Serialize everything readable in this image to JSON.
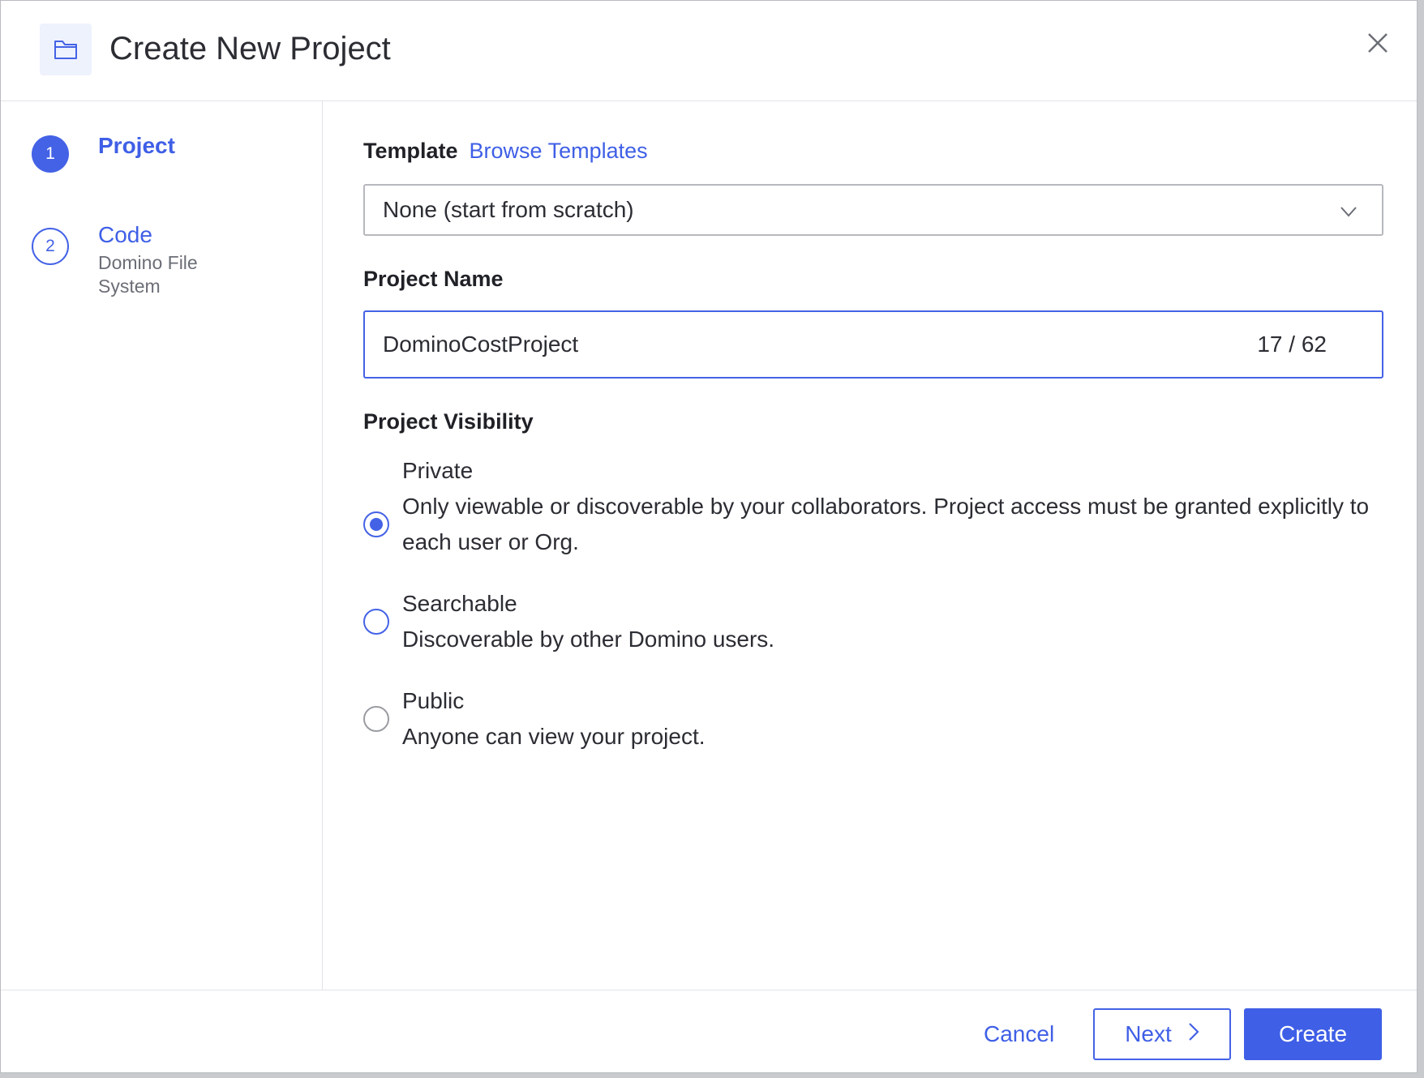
{
  "dialog": {
    "title": "Create New Project"
  },
  "steps": [
    {
      "number": "1",
      "label": "Project",
      "sub": ""
    },
    {
      "number": "2",
      "label": "Code",
      "sub": "Domino File System"
    }
  ],
  "form": {
    "template_label": "Template",
    "browse_templates": "Browse Templates",
    "template_value": "None (start from scratch)",
    "project_name_label": "Project Name",
    "project_name_value": "DominoCostProject",
    "project_name_counter": "17 / 62",
    "visibility_label": "Project Visibility",
    "visibility_options": [
      {
        "title": "Private",
        "desc": "Only viewable or discoverable by your collaborators. Project access must be granted explicitly to each user or Org.",
        "selected": true
      },
      {
        "title": "Searchable",
        "desc": "Discoverable by other Domino users.",
        "selected": false
      },
      {
        "title": "Public",
        "desc": "Anyone can view your project.",
        "selected": false
      }
    ]
  },
  "footer": {
    "cancel": "Cancel",
    "next": "Next",
    "create": "Create"
  },
  "icons": {
    "header": "folder-icon",
    "close": "close-icon",
    "select": "chevron-down-icon",
    "next": "chevron-right-icon"
  },
  "colors": {
    "accent": "#4462e6",
    "text": "#2b2d33",
    "muted": "#6b6e76"
  }
}
